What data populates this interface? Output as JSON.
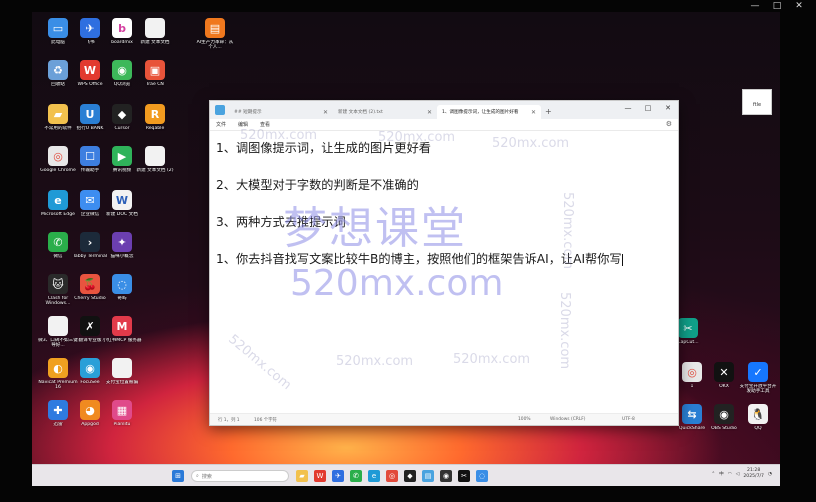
{
  "recorder": {
    "minimize": "—",
    "maximize": "□",
    "close": "✕"
  },
  "desktop_icons": [
    {
      "name": "desktop-icon-this-pc",
      "label": "此电脑",
      "icon": "monitor-icon",
      "color": "#3a8ee6",
      "glyph": "▭"
    },
    {
      "name": "desktop-icon-feishu",
      "label": "飞书",
      "icon": "feishu-icon",
      "color": "#2f6fe0",
      "glyph": "✈"
    },
    {
      "name": "desktop-icon-boardmix",
      "label": "boardmix",
      "icon": "boardmix-icon",
      "color": "#ffffff",
      "glyph": "b",
      "fg": "#d43fa0"
    },
    {
      "name": "desktop-icon-new-text-doc",
      "label": "新建 文本文档",
      "icon": "text-file-icon",
      "color": "#f2f2f2",
      "glyph": "",
      "fg": "#888"
    },
    {
      "name": "desktop-icon-ai-file",
      "label": "AI生产力革命：从个人...",
      "icon": "pdf-file-icon",
      "color": "#f0781e",
      "glyph": "▤"
    },
    {
      "name": "desktop-icon-recycle-bin",
      "label": "回收站",
      "icon": "recycle-bin-icon",
      "color": "#6ba0d8",
      "glyph": "♻"
    },
    {
      "name": "desktop-icon-wps",
      "label": "WPS Office",
      "icon": "wps-icon",
      "color": "#e23a2f",
      "glyph": "W"
    },
    {
      "name": "desktop-icon-qq-browser",
      "label": "QQ浏览",
      "icon": "qq-browser-icon",
      "color": "#3db85a",
      "glyph": "◉"
    },
    {
      "name": "desktop-icon-trae",
      "label": "Trae CN",
      "icon": "trae-icon",
      "color": "#e8533a",
      "glyph": "▣"
    },
    {
      "name": "desktop-icon-unclassified",
      "label": "不常用的软件",
      "icon": "folder-icon",
      "color": "#f2c14e",
      "glyph": "▰"
    },
    {
      "name": "desktop-icon-bank",
      "label": "招行U BANK",
      "icon": "bank-icon",
      "color": "#2a7fd4",
      "glyph": "U"
    },
    {
      "name": "desktop-icon-cursor",
      "label": "Cursor",
      "icon": "cursor-icon",
      "color": "#222222",
      "glyph": "◆"
    },
    {
      "name": "desktop-icon-reqable",
      "label": "Reqable",
      "icon": "reqable-icon",
      "color": "#f29b1f",
      "glyph": "R"
    },
    {
      "name": "desktop-icon-chrome",
      "label": "Google Chrome",
      "icon": "chrome-icon",
      "color": "#e8e8e8",
      "glyph": "◎",
      "fg": "#e24a3b"
    },
    {
      "name": "desktop-icon-assistant",
      "label": "传输助手",
      "icon": "assistant-icon",
      "color": "#3d7fe0",
      "glyph": "☐"
    },
    {
      "name": "desktop-icon-tencent-video",
      "label": "腾讯视频",
      "icon": "video-icon",
      "color": "#2fb35a",
      "glyph": "▶"
    },
    {
      "name": "desktop-icon-new-text-doc-2",
      "label": "新建 文本文档 (2)",
      "icon": "text-file-icon",
      "color": "#f2f2f2",
      "glyph": "",
      "fg": "#888"
    },
    {
      "name": "desktop-icon-edge",
      "label": "Microsoft Edge",
      "icon": "edge-icon",
      "color": "#1f9ad6",
      "glyph": "e"
    },
    {
      "name": "desktop-icon-wecom",
      "label": "企业微信",
      "icon": "wecom-icon",
      "color": "#3d8df0",
      "glyph": "✉"
    },
    {
      "name": "desktop-icon-new-doc",
      "label": "新建 DOC 文档",
      "icon": "doc-file-icon",
      "color": "#f2f2f2",
      "glyph": "W",
      "fg": "#2b5fb8"
    },
    {
      "name": "desktop-icon-wechat",
      "label": "微信",
      "icon": "wechat-icon",
      "color": "#2aae4a",
      "glyph": "✆"
    },
    {
      "name": "desktop-icon-tabby",
      "label": "Tabby Terminal",
      "icon": "terminal-icon",
      "color": "#1c2a3a",
      "glyph": "›"
    },
    {
      "name": "desktop-icon-miniprogram",
      "label": "猫咪小概念",
      "icon": "app-icon",
      "color": "#6b3fb0",
      "glyph": "✦"
    },
    {
      "name": "desktop-icon-clash",
      "label": "Clash for Windows...",
      "icon": "clash-icon",
      "color": "#2a2a2a",
      "glyph": "🐱"
    },
    {
      "name": "desktop-icon-cherry",
      "label": "Cherry Studio",
      "icon": "cherry-icon",
      "color": "#e8543f",
      "glyph": "🍒"
    },
    {
      "name": "desktop-icon-qiyu",
      "label": "奇屿",
      "icon": "qiyu-icon",
      "color": "#3a8ee6",
      "glyph": "◌"
    },
    {
      "name": "desktop-icon-file-3",
      "label": "微3、口碑不如三键导好...",
      "icon": "text-file-icon",
      "color": "#f2f2f2",
      "glyph": "",
      "fg": "#888"
    },
    {
      "name": "desktop-icon-trae-plus",
      "label": "翻译专业版",
      "icon": "translate-icon",
      "color": "#111111",
      "glyph": "✗"
    },
    {
      "name": "desktop-icon-xiaohongshu",
      "label": "小红书MCP 服务器",
      "icon": "xhs-icon",
      "color": "#e23a4a",
      "glyph": "M"
    },
    {
      "name": "desktop-icon-navicat",
      "label": "Navicat Premium 16",
      "icon": "navicat-icon",
      "color": "#f0a020",
      "glyph": "◐"
    },
    {
      "name": "desktop-icon-focusee",
      "label": "FocuSee",
      "icon": "focusee-icon",
      "color": "#2a9fd8",
      "glyph": "◉"
    },
    {
      "name": "desktop-icon-file-4",
      "label": "支付宝位置被骗",
      "icon": "text-file-icon",
      "color": "#f2f2f2",
      "glyph": "",
      "fg": "#888"
    },
    {
      "name": "desktop-icon-xunlei",
      "label": "迅雷",
      "icon": "xunlei-icon",
      "color": "#2f7be0",
      "glyph": "✚"
    },
    {
      "name": "desktop-icon-appgod",
      "label": "Appgod",
      "icon": "appgod-icon",
      "color": "#f08a20",
      "glyph": "◕"
    },
    {
      "name": "desktop-icon-pianlitu",
      "label": "Pianlitu",
      "icon": "pianlitu-icon",
      "color": "#e04a8a",
      "glyph": "▦"
    }
  ],
  "right_icons": [
    {
      "name": "desktop-icon-capcut",
      "label": "CapCut...",
      "icon": "capcut-icon",
      "color": "#10a08a",
      "glyph": "✂"
    },
    {
      "name": "desktop-icon-chrome-2",
      "label": "1",
      "icon": "chrome-icon",
      "color": "#e8e8e8",
      "glyph": "◎",
      "fg": "#e24a3b"
    },
    {
      "name": "desktop-icon-okx",
      "label": "OKX",
      "icon": "okx-icon",
      "color": "#111111",
      "glyph": "✕"
    },
    {
      "name": "desktop-icon-alipay-tool",
      "label": "支付宝开放平台开发助手工具",
      "icon": "alipay-icon",
      "color": "#1677ff",
      "glyph": "✓"
    },
    {
      "name": "desktop-icon-quickshare",
      "label": "QuickShare",
      "icon": "share-icon",
      "color": "#2a7fd4",
      "glyph": "⇆"
    },
    {
      "name": "desktop-icon-obs",
      "label": "OBS Studio",
      "icon": "obs-icon",
      "color": "#222222",
      "glyph": "◉"
    },
    {
      "name": "desktop-icon-qq",
      "label": "QQ",
      "icon": "qq-icon",
      "color": "#f2f2f2",
      "glyph": "🐧"
    }
  ],
  "notepad": {
    "tabs": [
      {
        "label": "## 短期提示",
        "active": false
      },
      {
        "label": "新建 文本文档 (2).txt",
        "active": false
      },
      {
        "label": "1、调图像提示词，让生成的图片好看",
        "active": true
      }
    ],
    "menu": [
      "文件",
      "编辑",
      "查看"
    ],
    "lines": [
      "1、调图像提示词，让生成的图片更好看",
      "2、大模型对于字数的判断是不准确的",
      "3、两种方式去推提示词",
      "1、你去抖音找写文案比较牛B的博主，按照他们的框架告诉AI，让AI帮你写"
    ],
    "status": {
      "position": "行 1，列 1",
      "chars": "106 个字符",
      "zoom": "100%",
      "line_ending": "Windows (CRLF)",
      "encoding": "UTF-8"
    }
  },
  "float_widget": {
    "line1": "",
    "line2": "ftle"
  },
  "watermark": {
    "title": "梦想课堂",
    "url": "520mx.com",
    "small": "520mx.com"
  },
  "taskbar": {
    "search_placeholder": "搜索",
    "pinned": [
      {
        "name": "taskbar-explorer",
        "icon": "folder-icon",
        "color": "#f2c14e",
        "glyph": "▰"
      },
      {
        "name": "taskbar-wps",
        "icon": "wps-icon",
        "color": "#e23a2f",
        "glyph": "W"
      },
      {
        "name": "taskbar-feishu",
        "icon": "feishu-icon",
        "color": "#2f6fe0",
        "glyph": "✈"
      },
      {
        "name": "taskbar-wechat",
        "icon": "wechat-icon",
        "color": "#2aae4a",
        "glyph": "✆"
      },
      {
        "name": "taskbar-edge",
        "icon": "edge-icon",
        "color": "#1f9ad6",
        "glyph": "e"
      },
      {
        "name": "taskbar-chrome",
        "icon": "chrome-icon",
        "color": "#e24a3b",
        "glyph": "◎"
      },
      {
        "name": "taskbar-cursor",
        "icon": "cursor-icon",
        "color": "#222222",
        "glyph": "◆"
      },
      {
        "name": "taskbar-notepad",
        "icon": "notepad-icon",
        "color": "#4aa3df",
        "glyph": "▤"
      },
      {
        "name": "taskbar-obs",
        "icon": "obs-icon",
        "color": "#333333",
        "glyph": "◉"
      },
      {
        "name": "taskbar-capcut",
        "icon": "capcut-icon",
        "color": "#111111",
        "glyph": "✂"
      },
      {
        "name": "taskbar-app",
        "icon": "app-icon",
        "color": "#3a8ee6",
        "glyph": "◌"
      }
    ],
    "tray": {
      "lang": "中",
      "time": "21:28",
      "date": "2025/7/7"
    }
  }
}
